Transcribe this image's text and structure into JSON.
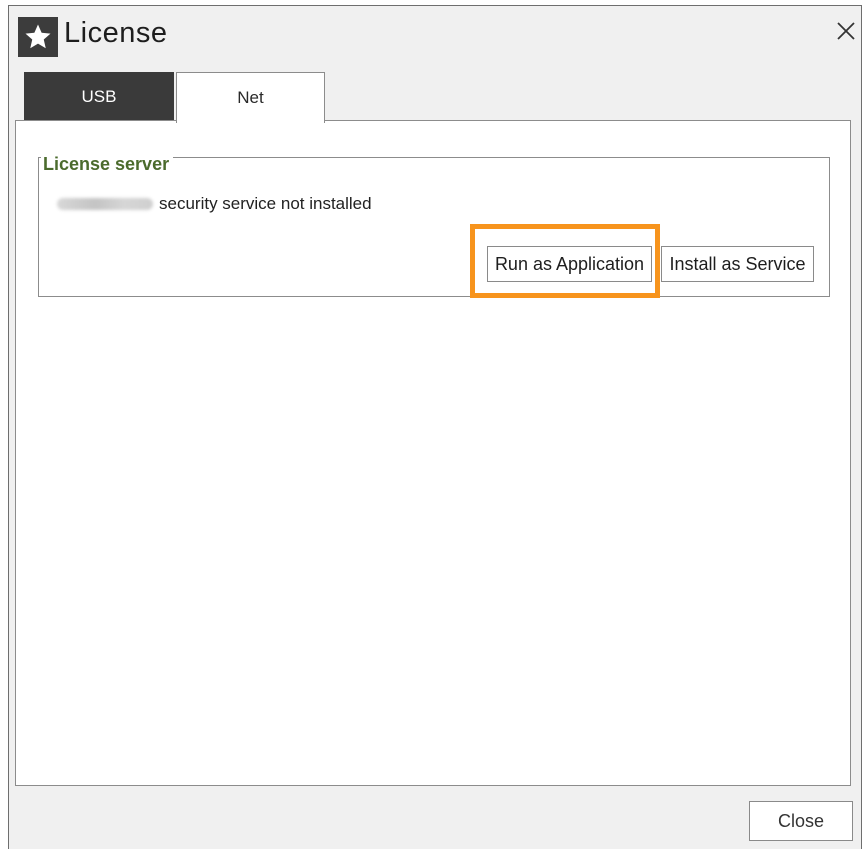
{
  "window": {
    "title": "License",
    "close_glyph": "✕"
  },
  "tabs": [
    {
      "label": "USB",
      "active": false
    },
    {
      "label": "Net",
      "active": true
    }
  ],
  "license_server": {
    "group_title": "License server",
    "status_text": "security service not installed",
    "run_button": "Run as Application",
    "install_button": "Install as Service"
  },
  "footer": {
    "close_button": "Close"
  },
  "colors": {
    "highlight": "#f7941d",
    "group_title": "#4b6b2d",
    "tab_inactive_bg": "#3a3a3a"
  },
  "icons": {
    "app": "star-icon",
    "close": "close-icon"
  }
}
